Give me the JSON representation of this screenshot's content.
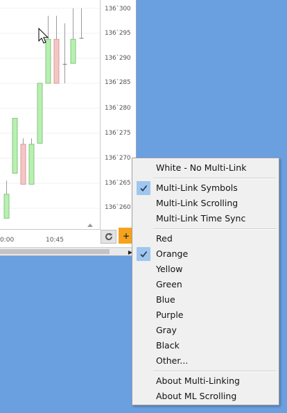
{
  "chart": {
    "y_axis_labels": [
      "136`300",
      "136`295",
      "136`290",
      "136`285",
      "136`280",
      "136`275",
      "136`270",
      "136`265",
      "136`260"
    ],
    "x_axis_labels": [
      "0:00",
      "10:45"
    ]
  },
  "chart_data": {
    "type": "candlestick",
    "ylim": [
      136.258,
      136.301
    ],
    "candles": [
      {
        "o": 136.2628,
        "h": 136.2655,
        "l": 136.2585,
        "c": 136.258,
        "dir": "up"
      },
      {
        "o": 136.278,
        "h": 136.278,
        "l": 136.267,
        "c": 136.267,
        "dir": "up"
      },
      {
        "o": 136.2728,
        "h": 136.274,
        "l": 136.2648,
        "c": 136.2648,
        "dir": "down"
      },
      {
        "o": 136.2728,
        "h": 136.274,
        "l": 136.2648,
        "c": 136.2648,
        "dir": "up"
      },
      {
        "o": 136.285,
        "h": 136.285,
        "l": 136.273,
        "c": 136.273,
        "dir": "up"
      },
      {
        "o": 136.2938,
        "h": 136.2985,
        "l": 136.285,
        "c": 136.285,
        "dir": "up"
      },
      {
        "o": 136.2938,
        "h": 136.2985,
        "l": 136.285,
        "c": 136.285,
        "dir": "down"
      },
      {
        "o": 136.2888,
        "h": 136.297,
        "l": 136.285,
        "c": 136.2888,
        "dir": "doji"
      },
      {
        "o": 136.2938,
        "h": 136.3,
        "l": 136.289,
        "c": 136.289,
        "dir": "up"
      },
      {
        "o": 136.294,
        "h": 136.3,
        "l": 136.294,
        "c": 136.294,
        "dir": "doji"
      }
    ]
  },
  "buttons": {
    "link_label": "+",
    "refresh_icon": "refresh-icon",
    "scroll_right_icon": "triangle-right-icon"
  },
  "menu": {
    "groups": [
      {
        "items": [
          {
            "label": "White - No Multi-Link",
            "checked": false
          }
        ]
      },
      {
        "items": [
          {
            "label": "Multi-Link Symbols",
            "checked": true
          },
          {
            "label": "Multi-Link Scrolling",
            "checked": false
          },
          {
            "label": "Multi-Link Time Sync",
            "checked": false
          }
        ]
      },
      {
        "items": [
          {
            "label": "Red",
            "checked": false
          },
          {
            "label": "Orange",
            "checked": true
          },
          {
            "label": "Yellow",
            "checked": false
          },
          {
            "label": "Green",
            "checked": false
          },
          {
            "label": "Blue",
            "checked": false
          },
          {
            "label": "Purple",
            "checked": false
          },
          {
            "label": "Gray",
            "checked": false
          },
          {
            "label": "Black",
            "checked": false
          },
          {
            "label": "Other...",
            "checked": false
          }
        ]
      },
      {
        "items": [
          {
            "label": "About Multi-Linking",
            "checked": false
          },
          {
            "label": "About ML Scrolling",
            "checked": false
          }
        ]
      }
    ]
  },
  "colors": {
    "desktop": "#6a9fe0",
    "up_candle": "#b7f0b0",
    "down_candle": "#f5c6c6",
    "link_orange": "#f6a21c",
    "check_highlight": "#9fc6ef"
  }
}
